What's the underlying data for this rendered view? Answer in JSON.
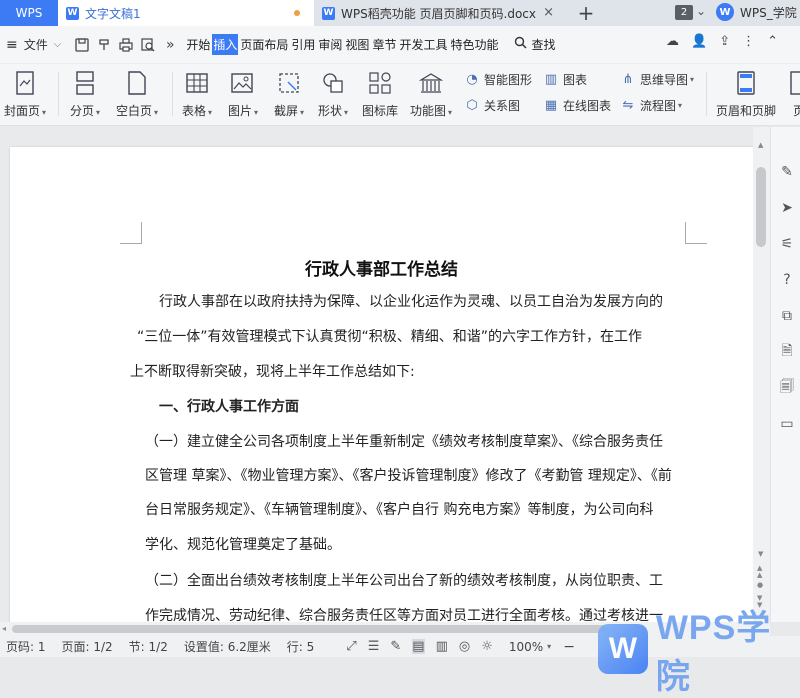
{
  "titlebar": {
    "wps_label": "WPS",
    "active_tab": "文字文稿1",
    "other_tab": "WPS稻壳功能 页眉页脚和页码.docx",
    "plus": "+",
    "tab_count": "2",
    "user_name": "WPS_学院"
  },
  "menubar": {
    "file_label": "文件",
    "more": "»",
    "tabs": [
      "开始",
      "插入",
      "页面布局",
      "引用",
      "审阅",
      "视图",
      "章节",
      "开发工具",
      "特色功能"
    ],
    "active_tab": "插入",
    "search_label": "查找"
  },
  "ribbon": {
    "cover": "封面页",
    "pagebreak": "分页",
    "blankpage": "空白页",
    "table": "表格",
    "picture": "图片",
    "screenshot": "截屏",
    "shape": "形状",
    "iconlib": "图标库",
    "funcchart": "功能图",
    "smartshape": "智能图形",
    "chart": "图表",
    "mindmap": "思维导图",
    "relation": "关系图",
    "onlinechart": "在线图表",
    "flowchart": "流程图",
    "headerfooter": "页眉和页脚",
    "page_cut": "页"
  },
  "document": {
    "title": "行政人事部工作总结",
    "lines": [
      "行政人事部在以政府扶持为保障、以企业化运作为灵魂、以员工自治为发展方向的",
      "“三位一体”有效管理模式下认真贯彻“积极、精细、和谐”的六字工作方针，在工作",
      "上不断取得新突破，现将上半年工作总结如下:",
      "一、行政人事工作方面",
      "（一）建立健全公司各项制度上半年重新制定《绩效考核制度草案》、《综合服务责任",
      "区管理  草案》、《物业管理方案》、《客户投诉管理制度》修改了《考勤管  理规定》、《前",
      "台日常服务规定》、《车辆管理制度》、《客户自行  购充电方案》等制度，为公司向科",
      "学化、规范化管理奠定了基础。",
      "（二）全面出台绩效考核制度上半年公司出台了新的绩效考核制度，从岗位职责、工",
      "作完成情况、劳动纪律、综合服务责任区等方面对员工进行全面考核。通过考核进一"
    ]
  },
  "statusbar": {
    "page_num": "页码: 1",
    "pages": "页面: 1/2",
    "section": "节: 1/2",
    "setting": "设置值: 6.2厘米",
    "row": "行: 5",
    "zoom": "100%",
    "zoom_minus": "−"
  },
  "watermark": {
    "logo_letter": "W",
    "text": "WPS学院"
  }
}
